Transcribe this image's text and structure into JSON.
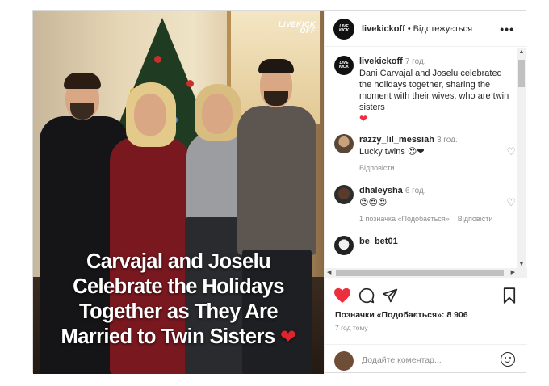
{
  "post": {
    "account": "livekickoff",
    "avatar_text": "LIVEKICK OFF",
    "follow_status": "Відстежується",
    "more_icon": "more-horizontal-icon"
  },
  "media": {
    "watermark": "LIVEKICK OFF",
    "caption_lines": [
      "Carvajal and Joselu",
      "Celebrate the Holidays",
      "Together as They Are",
      "Married to Twin Sisters"
    ],
    "caption_emoji": "❤"
  },
  "description": {
    "user": "livekickoff",
    "time": "7 год.",
    "text": "Dani Carvajal and Joselu celebrated the holidays together, sharing the moment with their wives, who are twin sisters",
    "emoji": "❤"
  },
  "comments": [
    {
      "user": "razzy_lil_messiah",
      "time": "3 год.",
      "text": "Lucky twins 😍❤",
      "reply": "Відповісти",
      "likes": ""
    },
    {
      "user": "dhaleysha",
      "time": "6 год.",
      "text": "😍😍😍",
      "likes": "1 позначка «Подобається»",
      "reply": "Відповісти"
    },
    {
      "user": "be_bet01",
      "time": "",
      "text": "",
      "reply": "",
      "likes": ""
    }
  ],
  "actions": {
    "liked": true,
    "likes_label": "Позначки «Подобається»: 8 906",
    "posted_ago": "7 год тому",
    "comment_placeholder": "Додайте коментар..."
  },
  "colors": {
    "like_red": "#ed2e3c",
    "text": "#262626",
    "muted": "#8e8e8e"
  }
}
